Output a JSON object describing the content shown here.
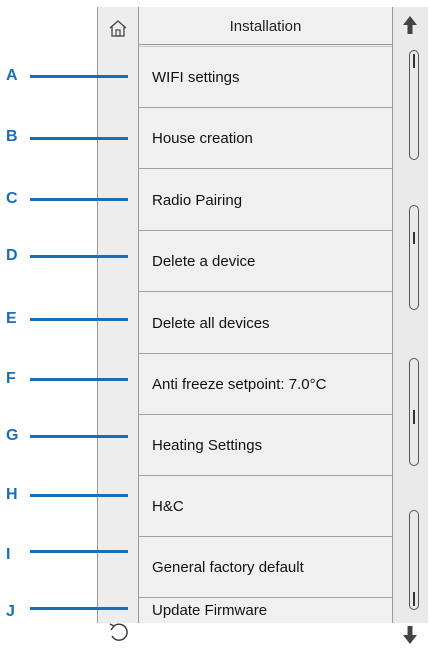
{
  "header": {
    "title": "Installation"
  },
  "menu": {
    "items": [
      {
        "letter": "A",
        "label": "WIFI settings"
      },
      {
        "letter": "B",
        "label": "House creation"
      },
      {
        "letter": "C",
        "label": "Radio Pairing"
      },
      {
        "letter": "D",
        "label": "Delete a device"
      },
      {
        "letter": "E",
        "label": "Delete all devices"
      },
      {
        "letter": "F",
        "label": "Anti freeze setpoint: 7.0°C"
      },
      {
        "letter": "G",
        "label": "Heating Settings"
      },
      {
        "letter": "H",
        "label": "H&C"
      },
      {
        "letter": "I",
        "label": "General factory default"
      },
      {
        "letter": "J",
        "label": "Update Firmware"
      }
    ]
  },
  "icons": {
    "home": "home-icon",
    "back": "back-icon",
    "scroll_up": "arrow-up-icon",
    "scroll_down": "arrow-down-icon"
  },
  "colors": {
    "callout": "#1a6eb8",
    "panel": "#f0f0f0"
  }
}
